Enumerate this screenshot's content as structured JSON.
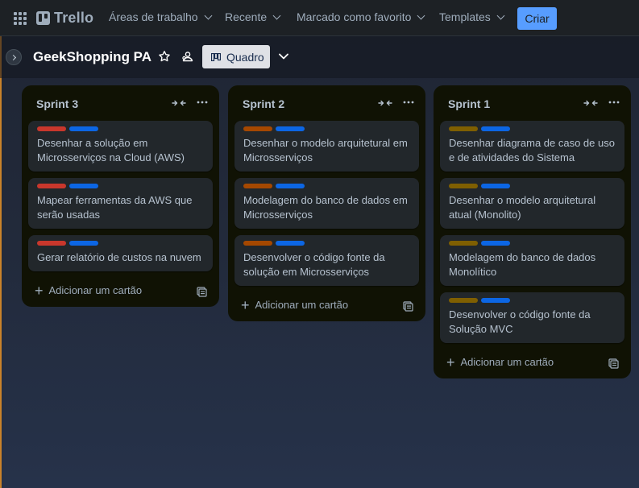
{
  "nav": {
    "brand": "Trello",
    "items": [
      {
        "label": "Áreas de trabalho"
      },
      {
        "label": "Recente"
      },
      {
        "label": "Marcado como favorito"
      },
      {
        "label": "Templates"
      }
    ],
    "create_label": "Criar"
  },
  "board": {
    "title": "GeekShopping PA",
    "view_label": "Quadro"
  },
  "colors": {
    "red": "#c9372c",
    "blue": "#0c66e4",
    "orange": "#a54800",
    "yellow": "#7f5f01",
    "accent": "#579dff"
  },
  "lists": [
    {
      "title": "Sprint 3",
      "add_label": "Adicionar um cartão",
      "cards": [
        {
          "title": "Desenhar a solução em Microsserviços na Cloud (AWS)",
          "labels": [
            "red",
            "blue"
          ]
        },
        {
          "title": "Mapear ferramentas da AWS que serão usadas",
          "labels": [
            "red",
            "blue"
          ]
        },
        {
          "title": "Gerar relatório de custos na nuvem",
          "labels": [
            "red",
            "blue"
          ]
        }
      ]
    },
    {
      "title": "Sprint 2",
      "add_label": "Adicionar um cartão",
      "cards": [
        {
          "title": "Desenhar o modelo arquitetural em Microsserviços",
          "labels": [
            "orange",
            "blue"
          ]
        },
        {
          "title": "Modelagem do banco de dados em Microsserviços",
          "labels": [
            "orange",
            "blue"
          ]
        },
        {
          "title": "Desenvolver o código fonte da solução em Microsserviços",
          "labels": [
            "orange",
            "blue"
          ]
        }
      ]
    },
    {
      "title": "Sprint 1",
      "add_label": "Adicionar um cartão",
      "cards": [
        {
          "title": "Desenhar diagrama de caso de uso e de atividades do Sistema",
          "labels": [
            "yellow",
            "blue"
          ]
        },
        {
          "title": "Desenhar o modelo arquitetural atual (Monolito)",
          "labels": [
            "yellow",
            "blue"
          ]
        },
        {
          "title": "Modelagem do banco de dados Monolítico",
          "labels": [
            "yellow",
            "blue"
          ]
        },
        {
          "title": "Desenvolver o código fonte da Solução MVC",
          "labels": [
            "yellow",
            "blue"
          ]
        }
      ]
    }
  ]
}
